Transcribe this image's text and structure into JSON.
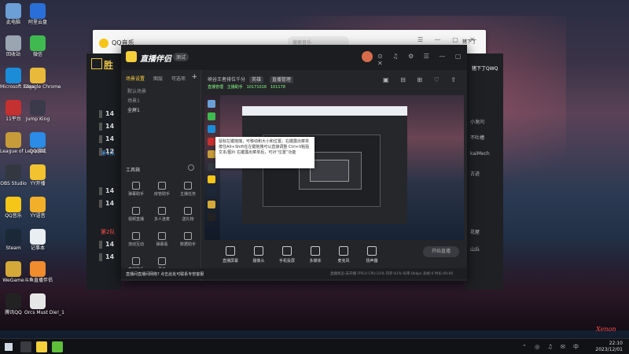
{
  "desktop": {
    "icons": [
      {
        "label": "此电脑",
        "color": "#6b9fd6"
      },
      {
        "label": "阿里云盘",
        "color": "#2a6fd8"
      },
      {
        "label": "回收站",
        "color": "#9aa5b1"
      },
      {
        "label": "微信",
        "color": "#3fb950"
      },
      {
        "label": "Microsoft Edge",
        "color": "#1a8cd8"
      },
      {
        "label": "Google Chrome",
        "color": "#e8b93a"
      },
      {
        "label": "11平台",
        "color": "#c53030"
      },
      {
        "label": "Jump King",
        "color": "#3a3a4a"
      },
      {
        "label": "League of Legends",
        "color": "#c79b3a"
      },
      {
        "label": "QQ游戏",
        "color": "#2b8be6"
      },
      {
        "label": "OBS Studio",
        "color": "#333840"
      },
      {
        "label": "YY开播",
        "color": "#f2c230"
      },
      {
        "label": "QQ音乐",
        "color": "#f5c518"
      },
      {
        "label": "YY语音",
        "color": "#f2b02a"
      },
      {
        "label": "Steam",
        "color": "#1b2838"
      },
      {
        "label": "记事本",
        "color": "#e9eef3"
      },
      {
        "label": "WeGame",
        "color": "#d4a93a"
      },
      {
        "label": "斗鱼直播伴侣",
        "color": "#f08c2e"
      },
      {
        "label": "腾讯QQ",
        "color": "#222222"
      },
      {
        "label": "Orcs Must Die!_1",
        "color": "#e6e6e6"
      }
    ]
  },
  "qqmusic": {
    "title": "QQ音乐",
    "search_placeholder": "搜索音乐",
    "user": "猪下丁",
    "controls": "☰ — ▢ ✕"
  },
  "gamewin": {
    "big_text": "胜",
    "team1": "第1队",
    "team2": "第2队",
    "numbers": [
      "14",
      "14",
      "14",
      "12",
      "14",
      "14",
      "14",
      "14"
    ]
  },
  "rightwin": {
    "header": "猪下丁QWQ",
    "items": [
      "小发问",
      "不吐槽",
      "kaiMech",
      "古迹",
      "花屋",
      "山丘"
    ]
  },
  "livewin": {
    "app_name": "直播伴侣",
    "version": "测试",
    "toolbar_icons": "⊙ ♫ ⚙ ☰ — ▢ ✕",
    "tabs": [
      "场景设置",
      "图层",
      "可选项"
    ],
    "scenes": [
      "默认场景",
      "场景1",
      "全屏1"
    ],
    "tools_header": "工具箱",
    "tools": [
      {
        "label": "弹幕助手"
      },
      {
        "label": "房管助手"
      },
      {
        "label": "主播任务"
      },
      {
        "label": "视频直播"
      },
      {
        "label": "多人连麦"
      },
      {
        "label": "送礼物"
      },
      {
        "label": "流动互动"
      },
      {
        "label": "弹幕看"
      },
      {
        "label": "数据助手"
      },
      {
        "label": "直播助手"
      },
      {
        "label": "更多"
      }
    ],
    "bottom_note": "直播间直播间网络? 点击此处可联系专管客服",
    "info": {
      "room": "峡谷王者排位千分",
      "tag1": "英雄",
      "tag2": "直播管理",
      "line2_parts": [
        "直播管理",
        "主播助手",
        "10171016",
        "101178"
      ]
    },
    "right_icons": "▣ ⊟ ⊞ ♡ ⇪",
    "tooltip": "鼠标左键拖拽，可移动和大小和位置。右键露出菜单 按住Alt+Shift在左键拖拽可以直接调整 Ctrl+V粘贴文本/图片 右键露出菜单后，可对“位置”功能",
    "controls": [
      {
        "label": "直播屏幕"
      },
      {
        "label": "摄像头"
      },
      {
        "label": "手机投屏"
      },
      {
        "label": "多媒体"
      },
      {
        "label": "麦克风"
      },
      {
        "label": "扬声器"
      }
    ],
    "golive": "开始直播",
    "status": "直播状态:未开播  FPS:0  CPU:21%  内存:41%  码率:0kbps  丢帧:0  时长:00:00"
  },
  "taskbar": {
    "tray": "⌃ ◎ ♫ ✉ 中",
    "time": "22:10",
    "date": "2023/12/01"
  },
  "watermark": "Xenon"
}
